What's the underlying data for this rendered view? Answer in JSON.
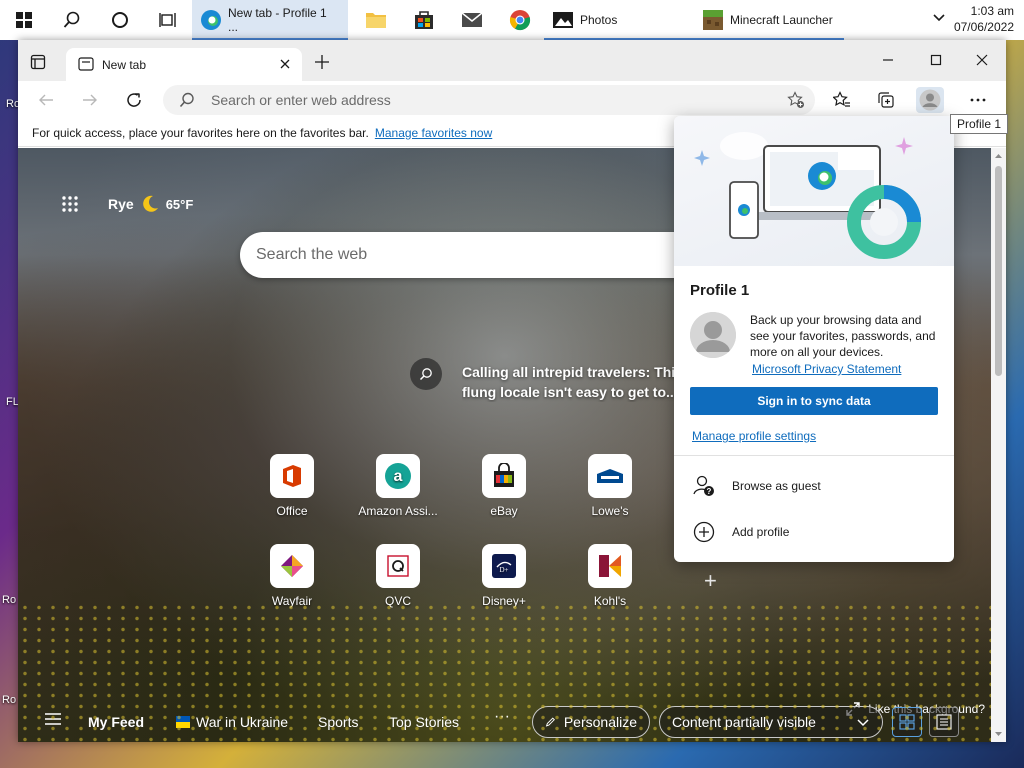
{
  "taskbar": {
    "apps": [
      {
        "name": "edge",
        "label": "New tab - Profile 1 ..."
      },
      {
        "name": "minecraft",
        "label": "Minecraft Launcher"
      }
    ],
    "photos_label": "Photos",
    "clock_time": "1:03 am",
    "clock_date": "07/06/2022"
  },
  "desktop": {
    "edge_labels": [
      "Ro",
      "FL",
      "Ro",
      "Ro"
    ]
  },
  "browser": {
    "tab_title": "New tab",
    "address_placeholder": "Search or enter web address",
    "favbar_text": "For quick access, place your favorites here on the favorites bar.",
    "favbar_link": "Manage favorites now",
    "profile_tooltip": "Profile 1"
  },
  "newtab": {
    "weather_city": "Rye",
    "weather_temp": "65°F",
    "search_placeholder": "Search the web",
    "story_line1": "Calling all intrepid travelers: This fa",
    "story_line2": "flung locale isn't easy to get to...",
    "sites": [
      {
        "label": "Office",
        "icon": "office-icon"
      },
      {
        "label": "Amazon Assi...",
        "icon": "amazon-assistant-icon"
      },
      {
        "label": "eBay",
        "icon": "ebay-icon"
      },
      {
        "label": "Lowe's",
        "icon": "lowes-icon"
      },
      {
        "label": "Wayfair",
        "icon": "wayfair-icon"
      },
      {
        "label": "QVC",
        "icon": "qvc-icon"
      },
      {
        "label": "Disney+",
        "icon": "disney-plus-icon"
      },
      {
        "label": "Kohl's",
        "icon": "kohls-icon"
      }
    ],
    "like_background": "Like this background?",
    "feed": {
      "my_feed": "My Feed",
      "war_in_ukraine": "War in Ukraine",
      "sports": "Sports",
      "top_stories": "Top Stories",
      "more": "···",
      "personalize": "Personalize",
      "content_visibility": "Content partially visible"
    }
  },
  "profile_flyout": {
    "name": "Profile 1",
    "description": "Back up your browsing data and see your favorites, passwords, and more on all your devices.",
    "privacy_link": "Microsoft Privacy Statement",
    "signin_button": "Sign in to sync data",
    "manage_link": "Manage profile settings",
    "browse_guest": "Browse as guest",
    "add_profile": "Add profile"
  },
  "colors": {
    "accent": "#0f6cbd",
    "taskbar_active": "#dbe6f3"
  }
}
